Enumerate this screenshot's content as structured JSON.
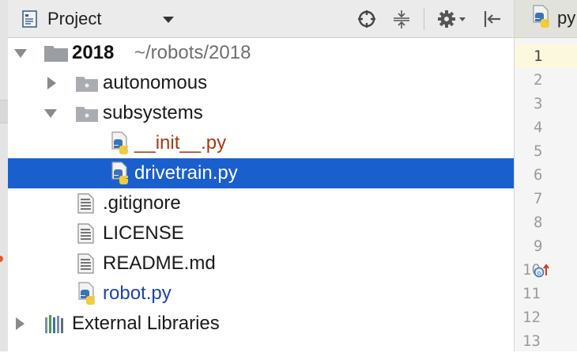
{
  "toolbar": {
    "title": "Project",
    "icons": [
      "project-icon",
      "dropdown-caret-icon",
      "locate-icon",
      "collapse-all-icon",
      "gear-icon",
      "hide-panel-icon"
    ]
  },
  "tree": {
    "items": [
      {
        "label": "2018",
        "path": "~/robots/2018",
        "type": "folder",
        "expanded": true
      },
      {
        "label": "autonomous",
        "type": "folder",
        "expanded": false
      },
      {
        "label": "subsystems",
        "type": "folder",
        "expanded": true
      },
      {
        "label": "__init__.py",
        "type": "python-file",
        "status": "modified"
      },
      {
        "label": "drivetrain.py",
        "type": "python-file",
        "selected": true
      },
      {
        "label": ".gitignore",
        "type": "text-file"
      },
      {
        "label": "LICENSE",
        "type": "text-file"
      },
      {
        "label": "README.md",
        "type": "text-file"
      },
      {
        "label": "robot.py",
        "type": "python-file",
        "status": "added"
      },
      {
        "label": "External Libraries",
        "type": "libraries",
        "expanded": false
      }
    ]
  },
  "editor": {
    "tab_label": "py",
    "line_numbers": [
      "1",
      "2",
      "3",
      "4",
      "5",
      "6",
      "7",
      "8",
      "9",
      "10",
      "11",
      "12",
      "13"
    ],
    "current_line": "1"
  },
  "colors": {
    "selection": "#1a5fce",
    "modified": "#a33b14",
    "added": "#2143a8",
    "python_blue": "#3a74b5",
    "python_yellow": "#f2cc3b"
  }
}
